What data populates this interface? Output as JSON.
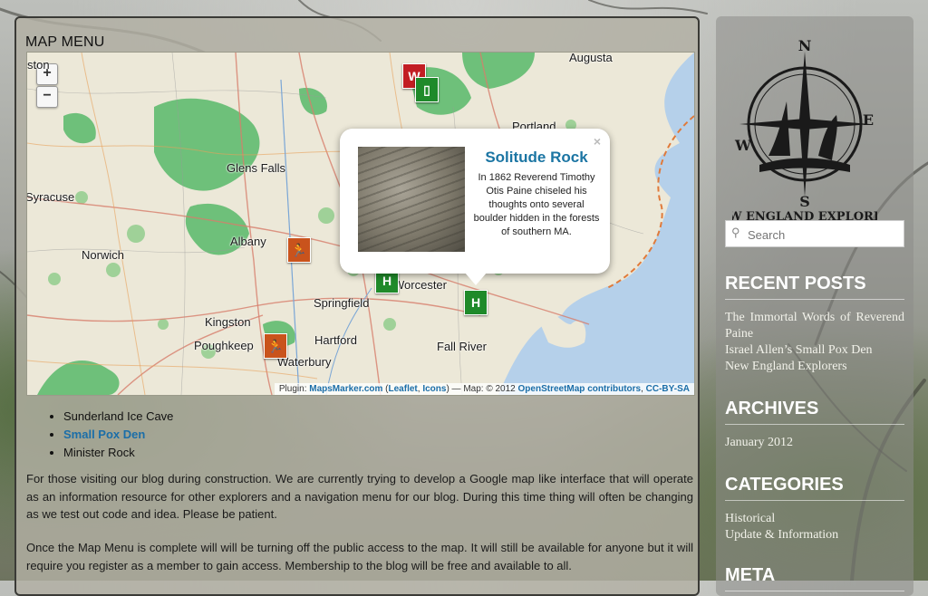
{
  "main": {
    "title": "MAP MENU",
    "map": {
      "zoom_in": "+",
      "zoom_out": "−",
      "cities": [
        "Augusta",
        "Portland",
        "Glens Falls",
        "Syracuse",
        "Albany",
        "Norwich",
        "Worcester",
        "Springfield",
        "Kingston",
        "Hartford",
        "Poughkeep",
        "Waterbury",
        "Fall River",
        "ston"
      ],
      "markers": {
        "orange_1": "🏃",
        "orange_2": "🏃",
        "green_1": "H",
        "green_2": "H",
        "green_3": "▯",
        "red_1": "W"
      },
      "popup": {
        "title": "Solitude Rock",
        "body": "In 1862 Reverend Timothy Otis Paine chiseled his thoughts onto several boulder hidden in the forests of southern MA.",
        "close": "×"
      },
      "attribution": {
        "prefix": "Plugin: ",
        "link1": "MapsMarker.com",
        "paren_open": " (",
        "link2": "Leaflet",
        "comma": ", ",
        "link3": "Icons",
        "mid": ") — Map: © 2012 ",
        "link4": "OpenStreetMap contributors",
        "comma2": ", ",
        "link5": "CC-BY-SA"
      }
    },
    "list": [
      "Sunderland Ice Cave",
      "Small Pox Den",
      "Minister Rock"
    ],
    "paragraphs": [
      "For those visiting our blog during construction. We are currently trying to develop a Google map like interface that will operate as an information resource for other explorers and a navigation menu for our blog. During this time thing will often be changing as we test out code and idea. Please be patient.",
      "Once the Map Menu is complete will will be turning off the public access to the map. It will still be available for anyone but it will require you register as a member to gain access. Membership to the blog will be free and available to all."
    ]
  },
  "sidebar": {
    "logo": {
      "n": "N",
      "s": "S",
      "e": "E",
      "w": "W",
      "text": "NEW ENGLAND EXPLORERS"
    },
    "search_placeholder": "Search",
    "recent_title": "RECENT POSTS",
    "recent": [
      "The Immortal Words of Reverend Paine",
      "Israel Allen’s Small Pox Den",
      "New England Explorers"
    ],
    "archives_title": "ARCHIVES",
    "archives": [
      "January 2012"
    ],
    "categories_title": "CATEGORIES",
    "categories": [
      "Historical",
      "Update & Information"
    ],
    "meta_title": "META"
  }
}
